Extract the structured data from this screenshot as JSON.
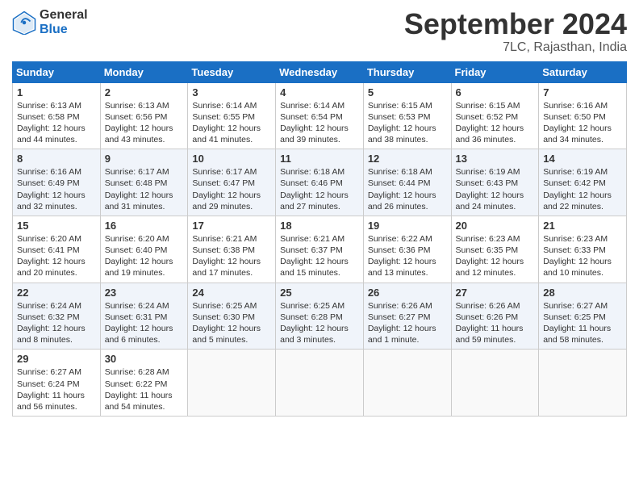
{
  "header": {
    "logo_general": "General",
    "logo_blue": "Blue",
    "month_title": "September 2024",
    "location": "7LC, Rajasthan, India"
  },
  "weekdays": [
    "Sunday",
    "Monday",
    "Tuesday",
    "Wednesday",
    "Thursday",
    "Friday",
    "Saturday"
  ],
  "weeks": [
    [
      {
        "day": "1",
        "sunrise": "6:13 AM",
        "sunset": "6:58 PM",
        "daylight": "12 hours and 44 minutes."
      },
      {
        "day": "2",
        "sunrise": "6:13 AM",
        "sunset": "6:56 PM",
        "daylight": "12 hours and 43 minutes."
      },
      {
        "day": "3",
        "sunrise": "6:14 AM",
        "sunset": "6:55 PM",
        "daylight": "12 hours and 41 minutes."
      },
      {
        "day": "4",
        "sunrise": "6:14 AM",
        "sunset": "6:54 PM",
        "daylight": "12 hours and 39 minutes."
      },
      {
        "day": "5",
        "sunrise": "6:15 AM",
        "sunset": "6:53 PM",
        "daylight": "12 hours and 38 minutes."
      },
      {
        "day": "6",
        "sunrise": "6:15 AM",
        "sunset": "6:52 PM",
        "daylight": "12 hours and 36 minutes."
      },
      {
        "day": "7",
        "sunrise": "6:16 AM",
        "sunset": "6:50 PM",
        "daylight": "12 hours and 34 minutes."
      }
    ],
    [
      {
        "day": "8",
        "sunrise": "6:16 AM",
        "sunset": "6:49 PM",
        "daylight": "12 hours and 32 minutes."
      },
      {
        "day": "9",
        "sunrise": "6:17 AM",
        "sunset": "6:48 PM",
        "daylight": "12 hours and 31 minutes."
      },
      {
        "day": "10",
        "sunrise": "6:17 AM",
        "sunset": "6:47 PM",
        "daylight": "12 hours and 29 minutes."
      },
      {
        "day": "11",
        "sunrise": "6:18 AM",
        "sunset": "6:46 PM",
        "daylight": "12 hours and 27 minutes."
      },
      {
        "day": "12",
        "sunrise": "6:18 AM",
        "sunset": "6:44 PM",
        "daylight": "12 hours and 26 minutes."
      },
      {
        "day": "13",
        "sunrise": "6:19 AM",
        "sunset": "6:43 PM",
        "daylight": "12 hours and 24 minutes."
      },
      {
        "day": "14",
        "sunrise": "6:19 AM",
        "sunset": "6:42 PM",
        "daylight": "12 hours and 22 minutes."
      }
    ],
    [
      {
        "day": "15",
        "sunrise": "6:20 AM",
        "sunset": "6:41 PM",
        "daylight": "12 hours and 20 minutes."
      },
      {
        "day": "16",
        "sunrise": "6:20 AM",
        "sunset": "6:40 PM",
        "daylight": "12 hours and 19 minutes."
      },
      {
        "day": "17",
        "sunrise": "6:21 AM",
        "sunset": "6:38 PM",
        "daylight": "12 hours and 17 minutes."
      },
      {
        "day": "18",
        "sunrise": "6:21 AM",
        "sunset": "6:37 PM",
        "daylight": "12 hours and 15 minutes."
      },
      {
        "day": "19",
        "sunrise": "6:22 AM",
        "sunset": "6:36 PM",
        "daylight": "12 hours and 13 minutes."
      },
      {
        "day": "20",
        "sunrise": "6:23 AM",
        "sunset": "6:35 PM",
        "daylight": "12 hours and 12 minutes."
      },
      {
        "day": "21",
        "sunrise": "6:23 AM",
        "sunset": "6:33 PM",
        "daylight": "12 hours and 10 minutes."
      }
    ],
    [
      {
        "day": "22",
        "sunrise": "6:24 AM",
        "sunset": "6:32 PM",
        "daylight": "12 hours and 8 minutes."
      },
      {
        "day": "23",
        "sunrise": "6:24 AM",
        "sunset": "6:31 PM",
        "daylight": "12 hours and 6 minutes."
      },
      {
        "day": "24",
        "sunrise": "6:25 AM",
        "sunset": "6:30 PM",
        "daylight": "12 hours and 5 minutes."
      },
      {
        "day": "25",
        "sunrise": "6:25 AM",
        "sunset": "6:28 PM",
        "daylight": "12 hours and 3 minutes."
      },
      {
        "day": "26",
        "sunrise": "6:26 AM",
        "sunset": "6:27 PM",
        "daylight": "12 hours and 1 minute."
      },
      {
        "day": "27",
        "sunrise": "6:26 AM",
        "sunset": "6:26 PM",
        "daylight": "11 hours and 59 minutes."
      },
      {
        "day": "28",
        "sunrise": "6:27 AM",
        "sunset": "6:25 PM",
        "daylight": "11 hours and 58 minutes."
      }
    ],
    [
      {
        "day": "29",
        "sunrise": "6:27 AM",
        "sunset": "6:24 PM",
        "daylight": "11 hours and 56 minutes."
      },
      {
        "day": "30",
        "sunrise": "6:28 AM",
        "sunset": "6:22 PM",
        "daylight": "11 hours and 54 minutes."
      },
      {
        "day": "",
        "sunrise": "",
        "sunset": "",
        "daylight": ""
      },
      {
        "day": "",
        "sunrise": "",
        "sunset": "",
        "daylight": ""
      },
      {
        "day": "",
        "sunrise": "",
        "sunset": "",
        "daylight": ""
      },
      {
        "day": "",
        "sunrise": "",
        "sunset": "",
        "daylight": ""
      },
      {
        "day": "",
        "sunrise": "",
        "sunset": "",
        "daylight": ""
      }
    ]
  ]
}
